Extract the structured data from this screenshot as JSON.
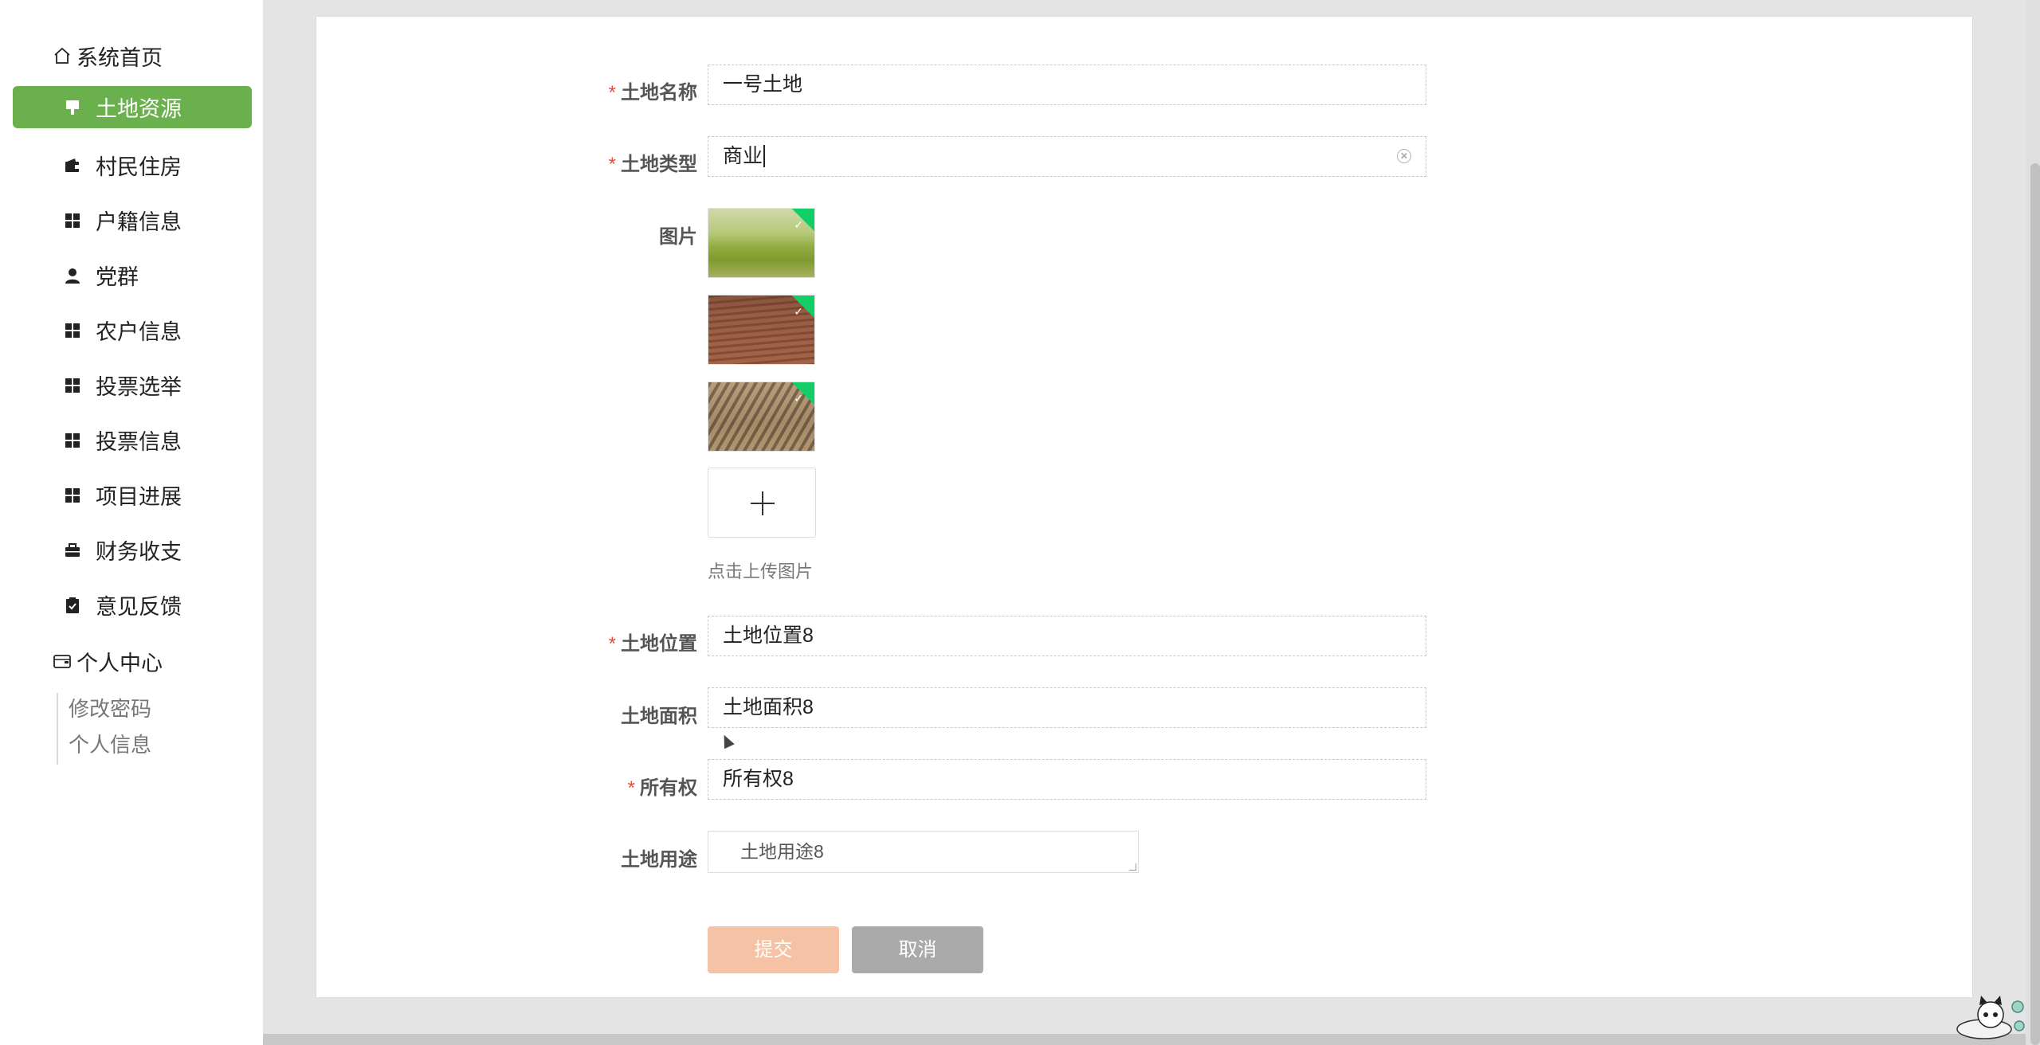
{
  "sidebar": {
    "home": "系统首页",
    "items": [
      {
        "label": "土地资源",
        "icon": "brush-icon",
        "active": true
      },
      {
        "label": "村民住房",
        "icon": "wallet-icon"
      },
      {
        "label": "户籍信息",
        "icon": "grid-icon"
      },
      {
        "label": "党群",
        "icon": "user-icon"
      },
      {
        "label": "农户信息",
        "icon": "grid-icon"
      },
      {
        "label": "投票选举",
        "icon": "grid-icon"
      },
      {
        "label": "投票信息",
        "icon": "grid-icon"
      },
      {
        "label": "项目进展",
        "icon": "grid-icon"
      },
      {
        "label": "财务收支",
        "icon": "briefcase-icon"
      },
      {
        "label": "意见反馈",
        "icon": "clipboard-check-icon"
      }
    ],
    "personal_center": "个人中心",
    "sub_items": [
      "修改密码",
      "个人信息"
    ]
  },
  "form": {
    "land_name": {
      "label": "土地名称",
      "value": "一号土地",
      "required": true
    },
    "land_type": {
      "label": "土地类型",
      "value": "商业",
      "required": true
    },
    "image": {
      "label": "图片",
      "upload_hint": "点击上传图片"
    },
    "land_location": {
      "label": "土地位置",
      "value": "土地位置8",
      "required": true
    },
    "land_area": {
      "label": "土地面积",
      "value": "土地面积8",
      "required": false
    },
    "ownership": {
      "label": "所有权",
      "value": "所有权8",
      "required": true
    },
    "land_use": {
      "label": "土地用途",
      "value": "土地用途8",
      "required": false
    },
    "submit_label": "提交",
    "cancel_label": "取消"
  },
  "colors": {
    "active_nav": "#6ab04c",
    "required_star": "#e74c3c",
    "submit_button": "#f5c2a6",
    "cancel_button": "#aaaaaa",
    "upload_success_badge": "#13ce66"
  }
}
